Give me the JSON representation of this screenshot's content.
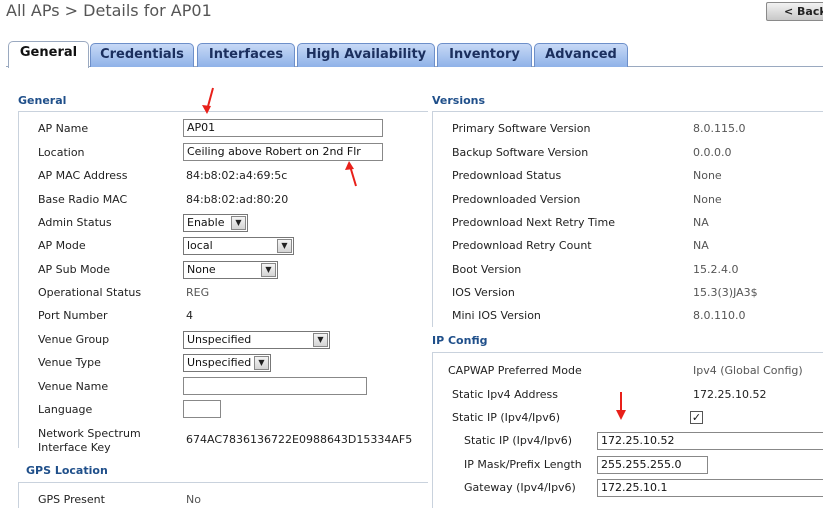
{
  "header": {
    "title": "All APs > Details for AP01",
    "back_label": "< Back"
  },
  "tabs": [
    "General",
    "Credentials",
    "Interfaces",
    "High Availability",
    "Inventory",
    "Advanced"
  ],
  "general": {
    "heading": "General",
    "ap_name_label": "AP Name",
    "ap_name_value": "AP01",
    "location_label": "Location",
    "location_value": "Ceiling above Robert on 2nd Flr",
    "mac_label": "AP MAC Address",
    "mac_value": "84:b8:02:a4:69:5c",
    "base_mac_label": "Base Radio MAC",
    "base_mac_value": "84:b8:02:ad:80:20",
    "admin_status_label": "Admin Status",
    "admin_status_value": "Enable",
    "ap_mode_label": "AP Mode",
    "ap_mode_value": "local",
    "ap_sub_mode_label": "AP Sub Mode",
    "ap_sub_mode_value": "None",
    "op_status_label": "Operational Status",
    "op_status_value": "REG",
    "port_label": "Port Number",
    "port_value": "4",
    "venue_group_label": "Venue Group",
    "venue_group_value": "Unspecified",
    "venue_type_label": "Venue Type",
    "venue_type_value": "Unspecified",
    "venue_name_label": "Venue Name",
    "venue_name_value": "",
    "language_label": "Language",
    "language_value": "",
    "spectrum_label_1": "Network Spectrum",
    "spectrum_label_2": "Interface Key",
    "spectrum_value": "674AC7836136722E0988643D15334AF5"
  },
  "gps": {
    "heading": "GPS Location",
    "present_label": "GPS Present",
    "present_value": "No"
  },
  "versions": {
    "heading": "Versions",
    "rows": [
      {
        "label": "Primary Software Version",
        "value": "8.0.115.0"
      },
      {
        "label": "Backup Software Version",
        "value": "0.0.0.0"
      },
      {
        "label": "Predownload Status",
        "value": "None"
      },
      {
        "label": "Predownloaded Version",
        "value": "None"
      },
      {
        "label": "Predownload Next Retry Time",
        "value": "NA"
      },
      {
        "label": "Predownload Retry Count",
        "value": "NA"
      },
      {
        "label": "Boot Version",
        "value": "15.2.4.0"
      },
      {
        "label": "IOS Version",
        "value": "15.3(3)JA3$"
      },
      {
        "label": "Mini IOS Version",
        "value": "8.0.110.0"
      }
    ]
  },
  "ip_config": {
    "heading": "IP Config",
    "capwap_label": "CAPWAP Preferred Mode",
    "capwap_value": "Ipv4 (Global Config)",
    "static_ipv4_label": "Static Ipv4 Address",
    "static_ipv4_value": "172.25.10.52",
    "static_ip_label": "Static IP (Ipv4/Ipv6)",
    "static_ip_checked": "✓",
    "static_ip_field_label": "Static IP (Ipv4/Ipv6)",
    "static_ip_field_value": "172.25.10.52",
    "mask_label": "IP Mask/Prefix Length",
    "mask_value": "255.255.255.0",
    "gateway_label": "Gateway (Ipv4/Ipv6)",
    "gateway_value": "172.25.10.1"
  },
  "colors": {
    "section_heading": "#1f4f8a",
    "tab": "#9cbcec",
    "annotation_arrow": "#e8201a"
  }
}
